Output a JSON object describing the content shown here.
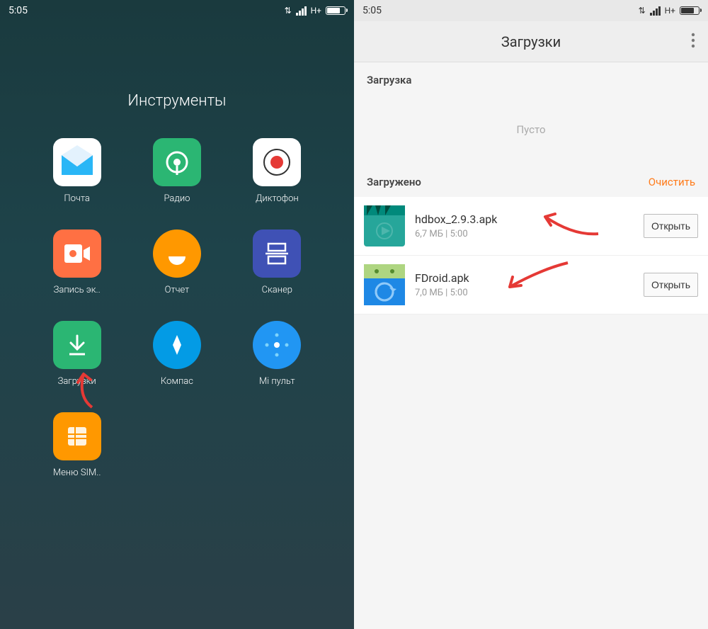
{
  "status": {
    "time": "5:05",
    "network": "H+"
  },
  "left": {
    "folder_title": "Инструменты",
    "apps": [
      {
        "label": "Почта"
      },
      {
        "label": "Радио"
      },
      {
        "label": "Диктофон"
      },
      {
        "label": "Запись эк.."
      },
      {
        "label": "Отчет"
      },
      {
        "label": "Сканер"
      },
      {
        "label": "Загрузки"
      },
      {
        "label": "Компас"
      },
      {
        "label": "Mi пульт"
      },
      {
        "label": "Меню SIM.."
      }
    ]
  },
  "right": {
    "title": "Загрузки",
    "section_downloading": "Загрузка",
    "empty": "Пусто",
    "section_downloaded": "Загружено",
    "clear": "Очистить",
    "open": "Открыть",
    "items": [
      {
        "name": "hdbox_2.9.3.apk",
        "meta": "6,7 МБ | 5:00"
      },
      {
        "name": "FDroid.apk",
        "meta": "7,0 МБ | 5:00"
      }
    ]
  }
}
